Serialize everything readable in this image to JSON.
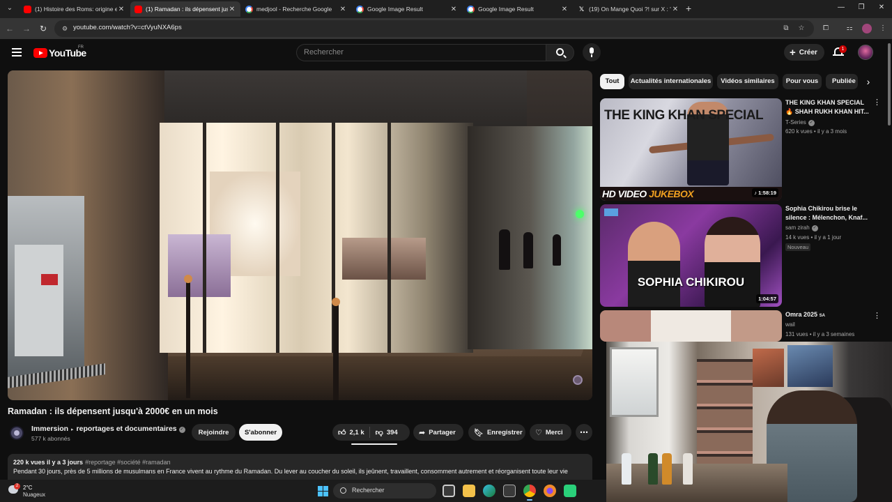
{
  "browser": {
    "tabs": [
      {
        "title": "(1) Histoire des Roms: origine e",
        "favicon": "youtube-icon",
        "active": false
      },
      {
        "title": "(1) Ramadan : ils dépensent jus",
        "favicon": "youtube-icon",
        "active": true
      },
      {
        "title": "medjool - Recherche Google",
        "favicon": "google-icon",
        "active": false
      },
      {
        "title": "Google Image Result",
        "favicon": "google-icon",
        "active": false
      },
      {
        "title": "Google Image Result",
        "favicon": "google-icon",
        "active": false
      },
      {
        "title": "(19) On Mange Quoi ?! sur X : \"",
        "favicon": "x-icon",
        "active": false
      }
    ],
    "url": "youtube.com/watch?v=ctVyuNXA6ps"
  },
  "youtube": {
    "logo_text": "YouTube",
    "country_code": "FR",
    "search_placeholder": "Rechercher",
    "create_label": "Créer",
    "notification_count": "1"
  },
  "video": {
    "title": "Ramadan : ils dépensent jusqu'à 2000€ en un mois",
    "channel": "Immersion",
    "channel_suffix": "reportages et documentaires",
    "subscribers": "577 k abonnés",
    "join_label": "Rejoindre",
    "subscribe_label": "S'abonner",
    "likes": "2,1 k",
    "dislikes": "394",
    "share_label": "Partager",
    "save_label": "Enregistrer",
    "thanks_label": "Merci",
    "views_date": "220 k vues  il y a 3 jours",
    "hashtags": "#reportage #société #ramadan",
    "description": "Pendant 30 jours, près de 5 millions de musulmans en France vivent au rythme du Ramadan. Du lever au coucher du soleil, ils jeûnent, travaillent, consomment autrement et réorganisent toute leur vie"
  },
  "chips": [
    "Tout",
    "Actualités internationales",
    "Vidéos similaires",
    "Pour vous",
    "Publiée"
  ],
  "recommendations": [
    {
      "title": "THE KING KHAN SPECIAL 🔥 SHAH RUKH KHAN HIT...",
      "channel": "T-Series",
      "verified": true,
      "meta": "620 k vues • il y a 3 mois",
      "duration": "1:58:19",
      "thumb_title": "THE KING KHAN SPECIAL",
      "thumb_strip_a": "HD VIDEO",
      "thumb_strip_b": "JUKEBOX"
    },
    {
      "title": "Sophia Chikirou brise le silence : Mélenchon, Knaf...",
      "channel": "sam zirah",
      "verified": true,
      "meta": "14 k vues • il y a 1 jour",
      "badge": "Nouveau",
      "duration": "1:04:57",
      "thumb_title": "SOPHIA CHIKIROU"
    },
    {
      "title": "Omra 2025",
      "title_suffix": "SA",
      "channel": "wail",
      "meta": "131 vues • il y a 3 semaines"
    }
  ],
  "taskbar": {
    "temperature": "2°C",
    "condition": "Nuageux",
    "weather_badge": "2",
    "search_label": "Rechercher"
  }
}
